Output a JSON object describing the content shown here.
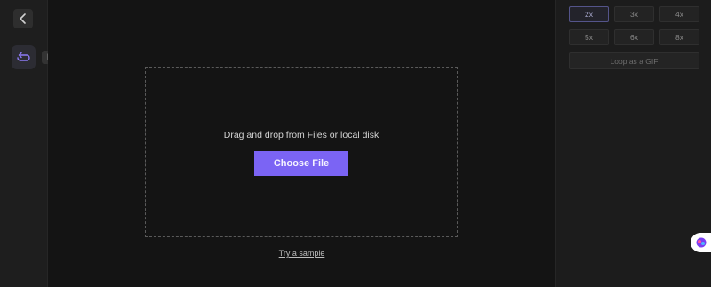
{
  "left_rail": {
    "back_icon": "chevron-left-icon",
    "loop_icon": "loop-icon",
    "loop_tooltip": "Loop"
  },
  "main": {
    "drop_text": "Drag and drop from Files or local disk",
    "choose_file_label": "Choose File",
    "try_sample_label": "Try a sample"
  },
  "right_panel": {
    "speed_options": [
      {
        "label": "2x",
        "selected": true
      },
      {
        "label": "3x",
        "selected": false
      },
      {
        "label": "4x",
        "selected": false
      },
      {
        "label": "5x",
        "selected": false
      },
      {
        "label": "6x",
        "selected": false
      },
      {
        "label": "8x",
        "selected": false
      }
    ],
    "gif_label": "Loop as a GIF"
  },
  "assistant": {
    "icon": "assistant-logo-icon"
  },
  "colors": {
    "accent": "#7b64f4",
    "background": "#141414",
    "panel": "#1c1c1c"
  }
}
